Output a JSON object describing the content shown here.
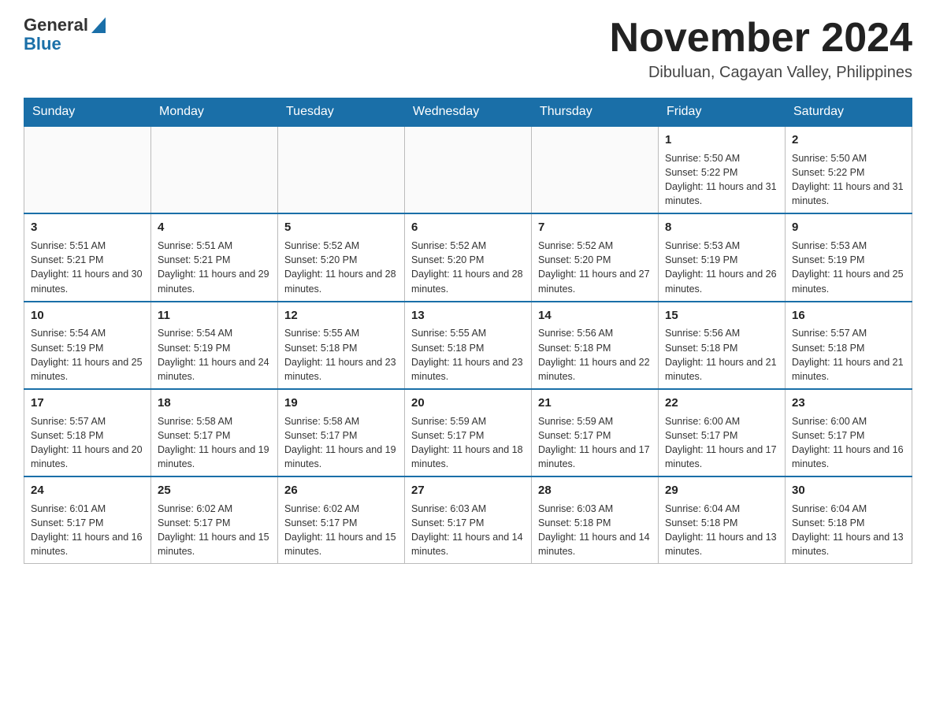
{
  "logo": {
    "general": "General",
    "blue": "Blue"
  },
  "title": "November 2024",
  "location": "Dibuluan, Cagayan Valley, Philippines",
  "weekdays": [
    "Sunday",
    "Monday",
    "Tuesday",
    "Wednesday",
    "Thursday",
    "Friday",
    "Saturday"
  ],
  "weeks": [
    [
      {
        "day": "",
        "info": ""
      },
      {
        "day": "",
        "info": ""
      },
      {
        "day": "",
        "info": ""
      },
      {
        "day": "",
        "info": ""
      },
      {
        "day": "",
        "info": ""
      },
      {
        "day": "1",
        "info": "Sunrise: 5:50 AM\nSunset: 5:22 PM\nDaylight: 11 hours and 31 minutes."
      },
      {
        "day": "2",
        "info": "Sunrise: 5:50 AM\nSunset: 5:22 PM\nDaylight: 11 hours and 31 minutes."
      }
    ],
    [
      {
        "day": "3",
        "info": "Sunrise: 5:51 AM\nSunset: 5:21 PM\nDaylight: 11 hours and 30 minutes."
      },
      {
        "day": "4",
        "info": "Sunrise: 5:51 AM\nSunset: 5:21 PM\nDaylight: 11 hours and 29 minutes."
      },
      {
        "day": "5",
        "info": "Sunrise: 5:52 AM\nSunset: 5:20 PM\nDaylight: 11 hours and 28 minutes."
      },
      {
        "day": "6",
        "info": "Sunrise: 5:52 AM\nSunset: 5:20 PM\nDaylight: 11 hours and 28 minutes."
      },
      {
        "day": "7",
        "info": "Sunrise: 5:52 AM\nSunset: 5:20 PM\nDaylight: 11 hours and 27 minutes."
      },
      {
        "day": "8",
        "info": "Sunrise: 5:53 AM\nSunset: 5:19 PM\nDaylight: 11 hours and 26 minutes."
      },
      {
        "day": "9",
        "info": "Sunrise: 5:53 AM\nSunset: 5:19 PM\nDaylight: 11 hours and 25 minutes."
      }
    ],
    [
      {
        "day": "10",
        "info": "Sunrise: 5:54 AM\nSunset: 5:19 PM\nDaylight: 11 hours and 25 minutes."
      },
      {
        "day": "11",
        "info": "Sunrise: 5:54 AM\nSunset: 5:19 PM\nDaylight: 11 hours and 24 minutes."
      },
      {
        "day": "12",
        "info": "Sunrise: 5:55 AM\nSunset: 5:18 PM\nDaylight: 11 hours and 23 minutes."
      },
      {
        "day": "13",
        "info": "Sunrise: 5:55 AM\nSunset: 5:18 PM\nDaylight: 11 hours and 23 minutes."
      },
      {
        "day": "14",
        "info": "Sunrise: 5:56 AM\nSunset: 5:18 PM\nDaylight: 11 hours and 22 minutes."
      },
      {
        "day": "15",
        "info": "Sunrise: 5:56 AM\nSunset: 5:18 PM\nDaylight: 11 hours and 21 minutes."
      },
      {
        "day": "16",
        "info": "Sunrise: 5:57 AM\nSunset: 5:18 PM\nDaylight: 11 hours and 21 minutes."
      }
    ],
    [
      {
        "day": "17",
        "info": "Sunrise: 5:57 AM\nSunset: 5:18 PM\nDaylight: 11 hours and 20 minutes."
      },
      {
        "day": "18",
        "info": "Sunrise: 5:58 AM\nSunset: 5:17 PM\nDaylight: 11 hours and 19 minutes."
      },
      {
        "day": "19",
        "info": "Sunrise: 5:58 AM\nSunset: 5:17 PM\nDaylight: 11 hours and 19 minutes."
      },
      {
        "day": "20",
        "info": "Sunrise: 5:59 AM\nSunset: 5:17 PM\nDaylight: 11 hours and 18 minutes."
      },
      {
        "day": "21",
        "info": "Sunrise: 5:59 AM\nSunset: 5:17 PM\nDaylight: 11 hours and 17 minutes."
      },
      {
        "day": "22",
        "info": "Sunrise: 6:00 AM\nSunset: 5:17 PM\nDaylight: 11 hours and 17 minutes."
      },
      {
        "day": "23",
        "info": "Sunrise: 6:00 AM\nSunset: 5:17 PM\nDaylight: 11 hours and 16 minutes."
      }
    ],
    [
      {
        "day": "24",
        "info": "Sunrise: 6:01 AM\nSunset: 5:17 PM\nDaylight: 11 hours and 16 minutes."
      },
      {
        "day": "25",
        "info": "Sunrise: 6:02 AM\nSunset: 5:17 PM\nDaylight: 11 hours and 15 minutes."
      },
      {
        "day": "26",
        "info": "Sunrise: 6:02 AM\nSunset: 5:17 PM\nDaylight: 11 hours and 15 minutes."
      },
      {
        "day": "27",
        "info": "Sunrise: 6:03 AM\nSunset: 5:17 PM\nDaylight: 11 hours and 14 minutes."
      },
      {
        "day": "28",
        "info": "Sunrise: 6:03 AM\nSunset: 5:18 PM\nDaylight: 11 hours and 14 minutes."
      },
      {
        "day": "29",
        "info": "Sunrise: 6:04 AM\nSunset: 5:18 PM\nDaylight: 11 hours and 13 minutes."
      },
      {
        "day": "30",
        "info": "Sunrise: 6:04 AM\nSunset: 5:18 PM\nDaylight: 11 hours and 13 minutes."
      }
    ]
  ]
}
